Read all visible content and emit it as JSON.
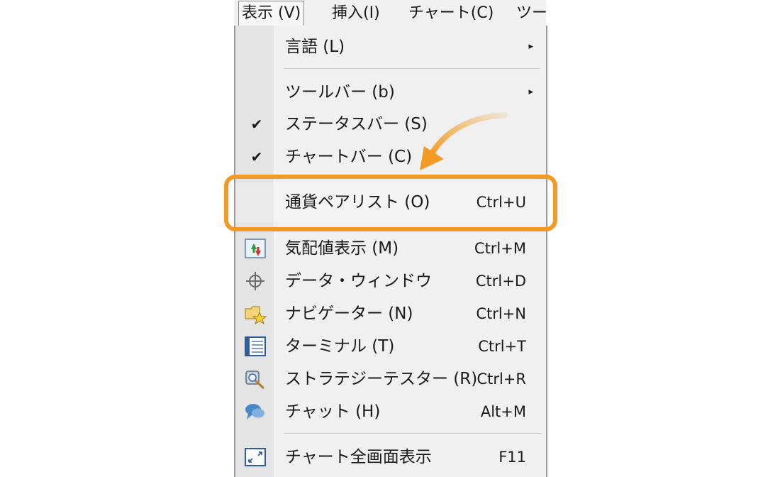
{
  "menubar": {
    "items": [
      {
        "label": "表示 (V)",
        "active": true
      },
      {
        "label": "挿入(I)",
        "active": false
      },
      {
        "label": "チャート(C)",
        "active": false
      },
      {
        "label": "ツー",
        "active": false
      }
    ]
  },
  "menu": {
    "items": [
      {
        "label": "言語 (L)",
        "submenu": true
      },
      {
        "label": "ツールバー (b)",
        "submenu": true
      },
      {
        "label": "ステータスバー (S)",
        "checked": true
      },
      {
        "label": "チャートバー (C)",
        "checked": true
      },
      {
        "label": "通貨ペアリスト (O)",
        "shortcut": "Ctrl+U",
        "highlighted": true
      },
      {
        "label": "気配値表示 (M)",
        "shortcut": "Ctrl+M",
        "icon": "market-watch-icon"
      },
      {
        "label": "データ・ウィンドウ",
        "shortcut": "Ctrl+D",
        "icon": "crosshair-icon"
      },
      {
        "label": "ナビゲーター (N)",
        "shortcut": "Ctrl+N",
        "icon": "navigator-folder-star-icon"
      },
      {
        "label": "ターミナル (T)",
        "shortcut": "Ctrl+T",
        "icon": "terminal-icon"
      },
      {
        "label": "ストラテジーテスター (R)",
        "shortcut": "Ctrl+R",
        "icon": "strategy-tester-icon"
      },
      {
        "label": "チャット (H)",
        "shortcut": "Alt+M",
        "icon": "chat-icon"
      },
      {
        "label": "チャート全画面表示",
        "shortcut": "F11",
        "icon": "fullscreen-icon"
      }
    ],
    "submenu_arrow": "▸",
    "checkmark": "✔"
  },
  "colors": {
    "highlight_border": "#f29a23",
    "arrow": "#f29a23",
    "menu_bg": "#f0f0f0"
  }
}
